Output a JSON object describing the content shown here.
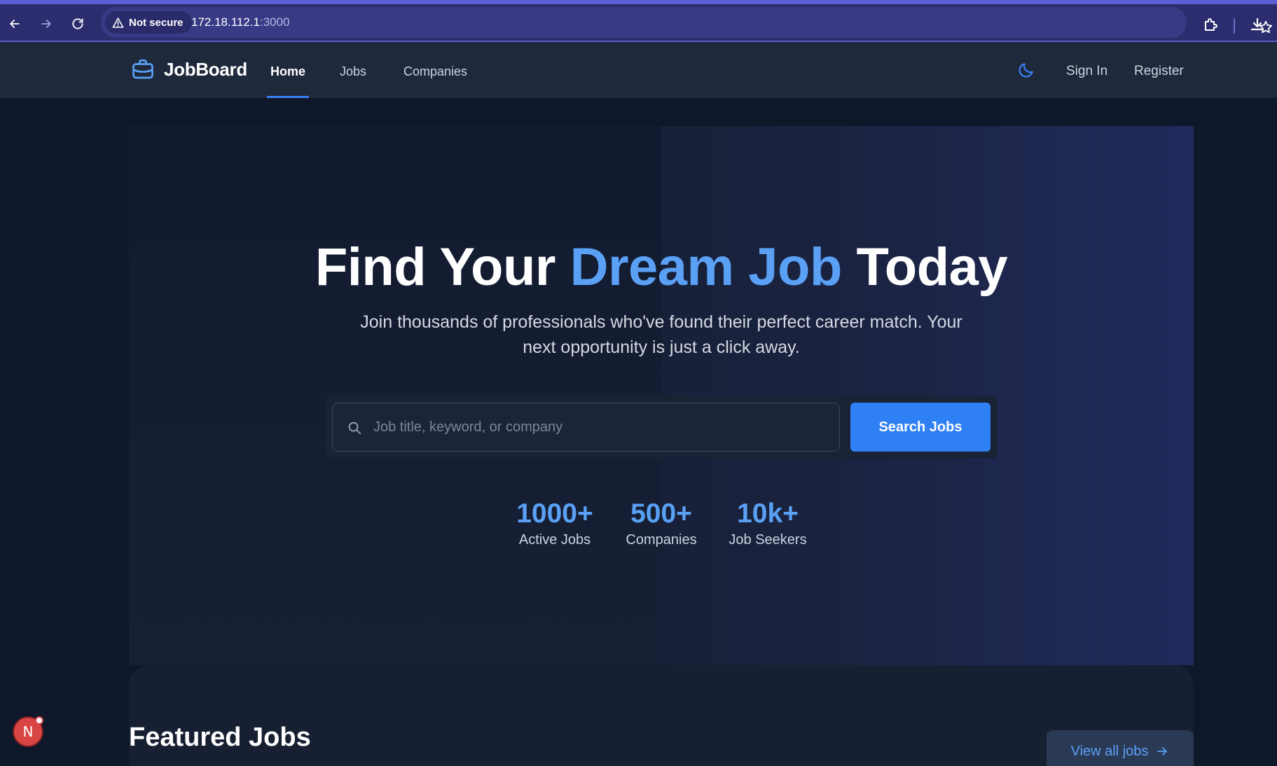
{
  "browser": {
    "security_label": "Not secure",
    "url_host": "172.18.112.1",
    "url_port": ":3000",
    "icons": [
      "back-icon",
      "forward-icon",
      "reload-icon",
      "warning-icon",
      "star-icon",
      "extensions-icon",
      "download-icon"
    ]
  },
  "header": {
    "brand": "JobBoard",
    "nav": [
      {
        "label": "Home",
        "active": true
      },
      {
        "label": "Jobs",
        "active": false
      },
      {
        "label": "Companies",
        "active": false
      }
    ],
    "sign_in": "Sign In",
    "register": "Register",
    "icons": [
      "briefcase-icon",
      "moon-icon"
    ]
  },
  "hero": {
    "title_start": "Find Your ",
    "title_accent": "Dream Job",
    "title_end": " Today",
    "subtitle_line1": "Join thousands of professionals who've found their perfect career match. Your",
    "subtitle_line2": "next opportunity is just a click away.",
    "search_placeholder": "Job title, keyword, or company",
    "search_button": "Search Jobs",
    "stats": [
      {
        "value": "1000+",
        "label": "Active Jobs"
      },
      {
        "value": "500+",
        "label": "Companies"
      },
      {
        "value": "10k+",
        "label": "Job Seekers"
      }
    ]
  },
  "featured": {
    "title": "Featured Jobs",
    "view_all": "View all jobs"
  },
  "avatar": {
    "initial": "N"
  },
  "colors": {
    "accent": "#3b82f6",
    "accent_text": "#5aa0f5",
    "page_bg": "#0f172a",
    "header_bg": "#1e293b",
    "browser_bar": "#2c2d6e"
  }
}
